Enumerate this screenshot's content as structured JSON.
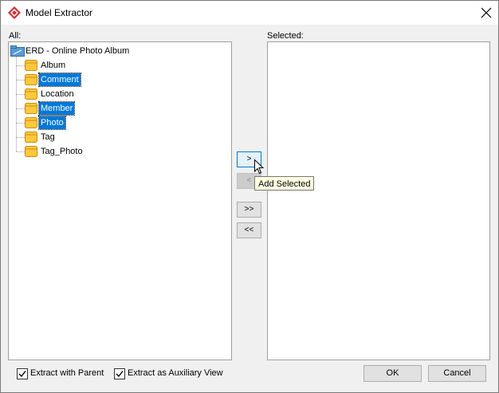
{
  "window": {
    "title": "Model Extractor",
    "icon": "visual-paradigm-logo-icon",
    "close_icon": "close-icon"
  },
  "all_panel": {
    "label": "All:",
    "root": {
      "label": "ERD - Online Photo Album",
      "icon": "erd-diagram-icon"
    },
    "items": [
      {
        "label": "Album",
        "selected": false,
        "icon": "entity-icon"
      },
      {
        "label": "Comment",
        "selected": true,
        "icon": "entity-icon"
      },
      {
        "label": "Location",
        "selected": false,
        "icon": "entity-icon"
      },
      {
        "label": "Member",
        "selected": true,
        "icon": "entity-icon"
      },
      {
        "label": "Photo",
        "selected": true,
        "icon": "entity-icon"
      },
      {
        "label": "Tag",
        "selected": false,
        "icon": "entity-icon"
      },
      {
        "label": "Tag_Photo",
        "selected": false,
        "icon": "entity-icon"
      }
    ]
  },
  "selected_panel": {
    "label": "Selected:",
    "items": []
  },
  "transfer_buttons": {
    "add_selected": ">",
    "remove_selected": "<",
    "add_all": ">>",
    "remove_all": "<<"
  },
  "tooltip": {
    "text": "Add Selected"
  },
  "options": {
    "extract_with_parent": {
      "label": "Extract with Parent",
      "checked": true
    },
    "extract_as_auxiliary_view": {
      "label": "Extract as Auxiliary View",
      "checked": true
    }
  },
  "footer": {
    "ok_label": "OK",
    "cancel_label": "Cancel"
  },
  "colors": {
    "selection": "#0078d7",
    "entity_fill": "#ffc83d",
    "tooltip_bg": "#ffffe1"
  }
}
